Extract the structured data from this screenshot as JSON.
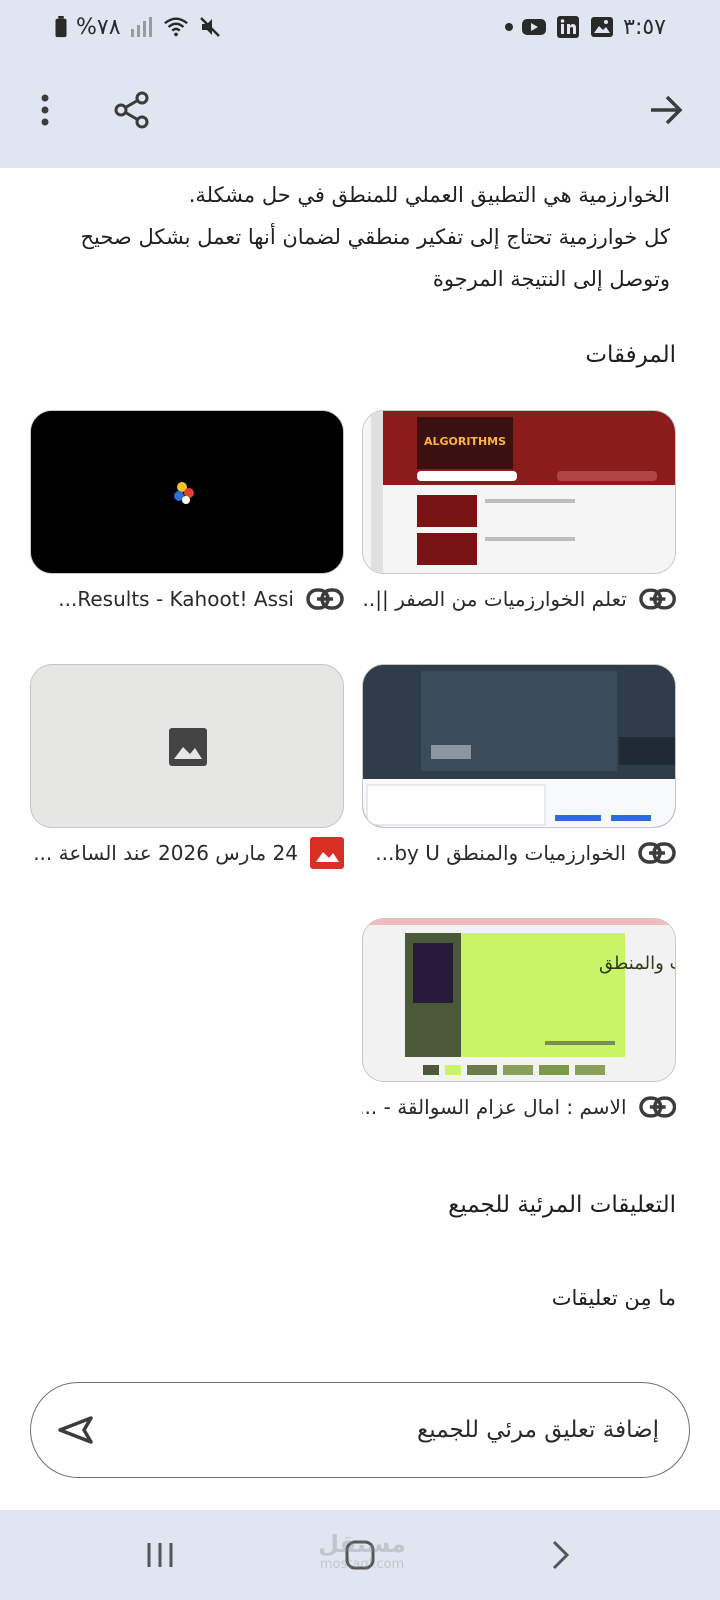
{
  "status_bar": {
    "time": "٣:٥٧",
    "battery": "%٧٨"
  },
  "app_bar": {
    "back_icon": "arrow-forward-icon",
    "share_icon": "share-icon",
    "more_icon": "more-vert-icon"
  },
  "description": {
    "lines": [
      "الخوارزمية هي التطبيق العملي للمنطق في حل مشكلة.",
      "كل خوارزمية تحتاج إلى تفكير منطقي لضمان أنها تعمل بشكل صحيح",
      "وتوصل إلى النتيجة المرجوة"
    ]
  },
  "attachments": {
    "title": "المرفقات",
    "items": [
      {
        "label": "تعلم الخوارزميات من الصفر ||...",
        "icon": "link-icon"
      },
      {
        "label": "Results - Kahoot! Assi...",
        "icon": "link-icon"
      },
      {
        "label": "الخوارزميات والمنطق by U...",
        "icon": "link-icon"
      },
      {
        "label": "24 مارس 2026 عند الساعة ...",
        "icon": "image-icon"
      },
      {
        "label": "الاسم : امال عزام السوالقة - ...",
        "icon": "link-icon"
      }
    ],
    "thumb3_text": "الخوارزميات والمنطق",
    "thumb0_text": "ALGORITHMS"
  },
  "comments": {
    "title": "التعليقات المرئية للجميع",
    "empty_text": "ما مِن تعليقات",
    "input_placeholder": "إضافة تعليق مرئي للجميع"
  },
  "watermark": {
    "line1": "مستقل",
    "line2": "mostaql.com"
  },
  "colors": {
    "bar_bg": "#dfe6f2",
    "image_icon_red": "#d93025"
  }
}
